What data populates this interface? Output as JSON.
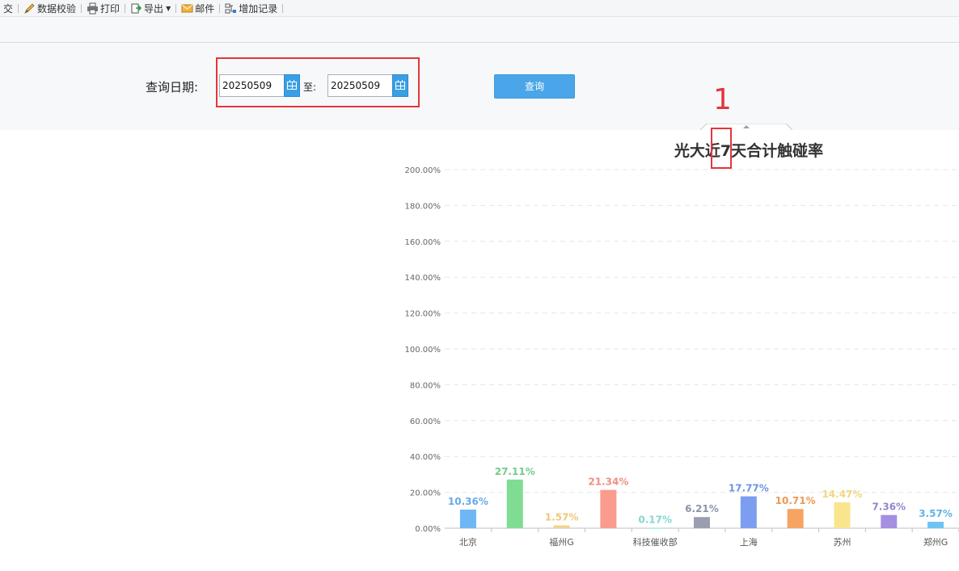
{
  "toolbar": {
    "items": [
      {
        "label": "交",
        "icon": "none"
      },
      {
        "label": "数据校验",
        "icon": "pencil-icon"
      },
      {
        "label": "打印",
        "icon": "printer-icon"
      },
      {
        "label": "导出",
        "icon": "export-icon"
      },
      {
        "label": "邮件",
        "icon": "mail-icon"
      },
      {
        "label": "增加记录",
        "icon": "add-record-icon"
      }
    ]
  },
  "query": {
    "label": "查询日期:",
    "start_date": "20250509",
    "to_label": "至:",
    "end_date": "20250509",
    "button_label": "查询"
  },
  "annotation": {
    "number": "1"
  },
  "colors": {
    "accent": "#4aa6e8",
    "highlight": "#e5353c"
  },
  "chart_data": {
    "type": "bar",
    "title": "光大近7天合计触碰率",
    "categories": [
      "北京",
      "",
      "福州G",
      "",
      "科技催收部",
      "",
      "上海",
      "",
      "苏州",
      "",
      "郑州G"
    ],
    "values": [
      10.36,
      27.11,
      1.57,
      21.34,
      0.17,
      6.21,
      17.77,
      10.71,
      14.47,
      7.36,
      3.57
    ],
    "data_labels": [
      "10.36%",
      "27.11%",
      "1.57%",
      "21.34%",
      "0.17%",
      "6.21%",
      "17.77%",
      "10.71%",
      "14.47%",
      "7.36%",
      "3.57%"
    ],
    "colors": [
      "#6fb6f5",
      "#7fdc92",
      "#f6d28b",
      "#f99b8d",
      "#8fe3dc",
      "#9b9eb1",
      "#7c9ef0",
      "#f6a461",
      "#f9e58d",
      "#a48fe0",
      "#6ec3f4"
    ],
    "label_colors": [
      "#6aa9e6",
      "#72cc88",
      "#efc77d",
      "#f18f80",
      "#86d7cf",
      "#8f93a8",
      "#6f94e5",
      "#eb9a55",
      "#efd77f",
      "#9684d3",
      "#5fb5e8"
    ],
    "y_ticks": [
      "0.00%",
      "20.00%",
      "40.00%",
      "60.00%",
      "80.00%",
      "100.00%",
      "120.00%",
      "140.00%",
      "160.00%",
      "180.00%",
      "200.00%"
    ],
    "ylim": [
      0,
      200
    ],
    "grid": true
  }
}
